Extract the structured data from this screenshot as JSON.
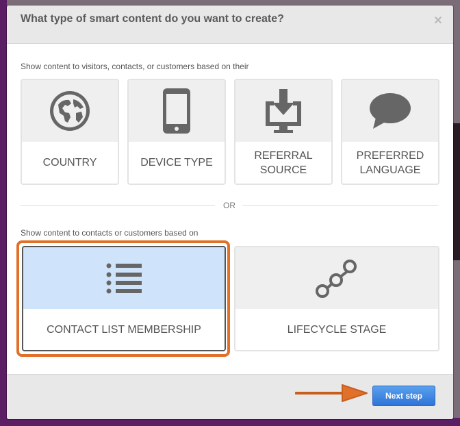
{
  "modal": {
    "title": "What type of smart content do you want to create?",
    "close_icon": "×"
  },
  "section1": {
    "label": "Show content to visitors, contacts, or customers based on their",
    "cards": [
      {
        "icon": "globe-icon",
        "label": "COUNTRY"
      },
      {
        "icon": "mobile-device-icon",
        "label": "DEVICE TYPE"
      },
      {
        "icon": "download-monitor-icon",
        "label": "REFERRAL SOURCE"
      },
      {
        "icon": "speech-bubble-icon",
        "label": "PREFERRED LANGUAGE"
      }
    ]
  },
  "divider": {
    "text": "OR"
  },
  "section2": {
    "label": "Show content to contacts or customers based on",
    "cards": [
      {
        "icon": "list-icon",
        "label": "CONTACT LIST MEMBERSHIP",
        "selected": true
      },
      {
        "icon": "lifecycle-nodes-icon",
        "label": "LIFECYCLE STAGE",
        "selected": false
      }
    ]
  },
  "footer": {
    "next_label": "Next step"
  },
  "colors": {
    "accent": "#2d74d8",
    "highlight": "#e0702a",
    "selected_bg": "#cfe4fb",
    "icon": "#666666"
  }
}
